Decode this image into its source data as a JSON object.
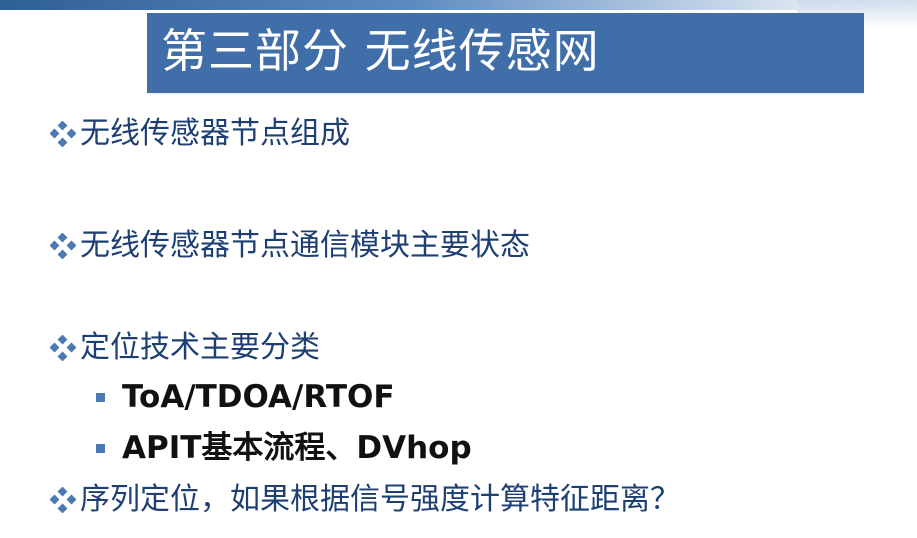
{
  "slide": {
    "title": "第三部分 无线传感网",
    "bullets": [
      {
        "text": "无线传感器节点组成"
      },
      {
        "text": "无线传感器节点通信模块主要状态"
      },
      {
        "text": "定位技术主要分类"
      },
      {
        "text": "序列定位，如果根据信号强度计算特征距离？"
      }
    ],
    "sub_bullets": [
      {
        "text": "ToA/TDOA/RTOF"
      },
      {
        "text": "APIT基本流程、DVhop"
      }
    ]
  },
  "colors": {
    "title_bg": "#3f6ea8",
    "title_text": "#ffffff",
    "bullet_text": "#1d3f73",
    "sub_text": "#111111",
    "bullet_icon": "#4b79b3"
  },
  "icons": {
    "bullet": "four-diamond-icon",
    "sub_bullet": "square-icon"
  }
}
